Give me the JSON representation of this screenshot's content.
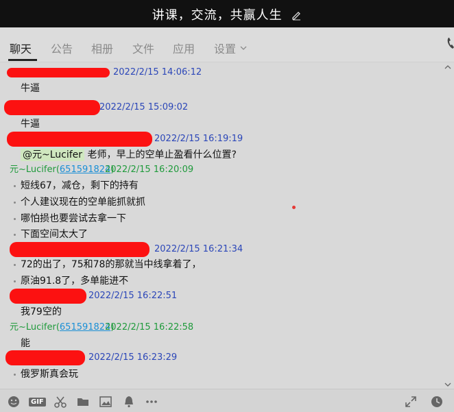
{
  "window": {
    "title": "讲课，交流，共赢人生"
  },
  "tabs": [
    "聊天",
    "公告",
    "相册",
    "文件",
    "应用",
    "设置"
  ],
  "messages": [
    {
      "time": "2022/2/15 14:06:12",
      "lines": [
        "牛逼"
      ]
    },
    {
      "time": "2022/2/15 15:09:02",
      "lines": [
        "牛逼"
      ]
    },
    {
      "time": "2022/2/15 16:19:19",
      "mention": "@元~Lucifer",
      "lines": [
        "老师，早上的空单止盈看什么位置?"
      ]
    },
    {
      "sender_name": "元~Lucifer(",
      "sender_qq": "651591824",
      "sender_close": ")",
      "time": "2022/2/15 16:20:09",
      "lines": [
        "短线67，减仓，剩下的持有",
        "个人建议现在的空单能抓就抓",
        "哪怕损也要尝试去拿一下",
        "下面空间太大了"
      ]
    },
    {
      "time": "2022/2/15 16:21:34",
      "lines": [
        "72的出了，75和78的那就当中线拿着了，",
        "原油91.8了，多单能进不"
      ]
    },
    {
      "time": "2022/2/15 16:22:51",
      "lines": [
        "我79空的"
      ]
    },
    {
      "sender_name": "元~Lucifer(",
      "sender_qq": "651591824",
      "sender_close": ")",
      "time": "2022/2/15 16:22:58",
      "lines": [
        "能"
      ]
    },
    {
      "time": "2022/2/15 16:23:29",
      "lines": [
        "俄罗斯真会玩"
      ]
    }
  ],
  "toolbar": {
    "gif_label": "GIF"
  },
  "colors": {
    "titlebar": "#111111",
    "timestamp": "#2b46b8",
    "sender": "#1f9a3b",
    "qq": "#1a8fd6",
    "redaction": "#ff0000"
  }
}
